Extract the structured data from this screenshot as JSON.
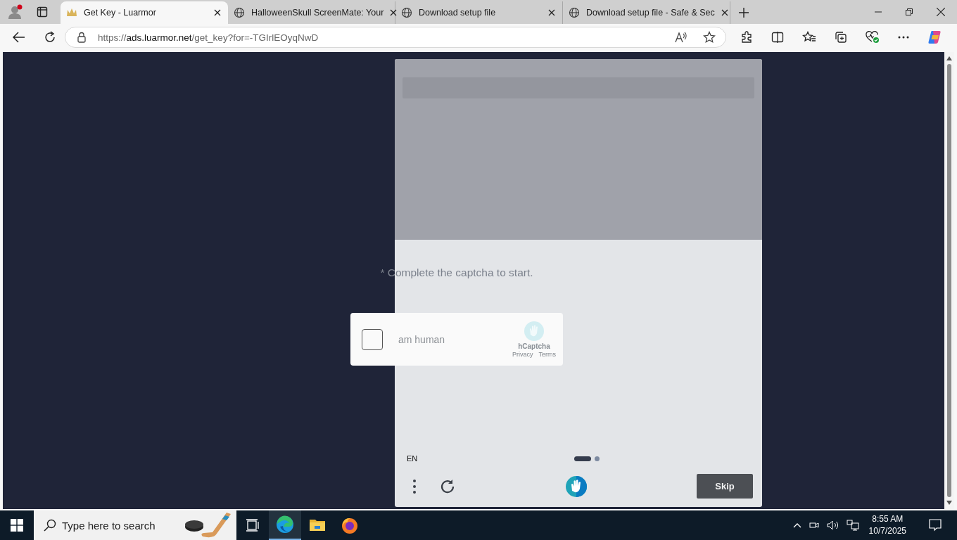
{
  "browser": {
    "tabs": [
      {
        "title": "Get Key - Luarmor",
        "kind": "site",
        "selected": true
      },
      {
        "title": "HalloweenSkull ScreenMate: Your",
        "kind": "globe",
        "selected": false
      },
      {
        "title": "Download setup file",
        "kind": "globe",
        "selected": false
      },
      {
        "title": "Download setup file - Safe & Sec",
        "kind": "globe",
        "selected": false
      }
    ],
    "address": {
      "scheme": "https://",
      "host": "ads.luarmor.net",
      "path": "/get_key?for=-TGIrlEOyqNwD"
    }
  },
  "page": {
    "notice": "* Complete the captcha to start.",
    "captcha_widget": {
      "label": "am human",
      "checked": false,
      "brand": "hCaptcha",
      "links": [
        "Privacy",
        "Terms"
      ]
    }
  },
  "challenge": {
    "language": "EN",
    "pages": [
      {
        "selected": true
      },
      {
        "selected": false
      }
    ],
    "skip_button": "Skip"
  },
  "taskbar": {
    "search_placeholder": "Type here to search",
    "apps": [
      {
        "kind": "taskview",
        "selected": false
      },
      {
        "kind": "edge",
        "selected": true
      },
      {
        "kind": "explorer",
        "selected": false
      },
      {
        "kind": "firefox",
        "selected": false
      }
    ],
    "time": "8:55 AM",
    "date": "10/7/2025"
  }
}
